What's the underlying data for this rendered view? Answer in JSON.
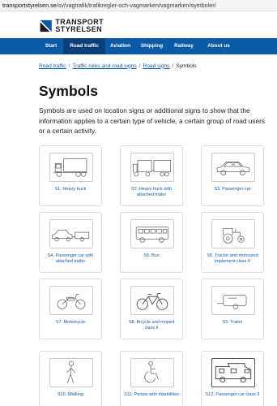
{
  "browser": {
    "url_host": "transportstyrelsen.se",
    "url_path": "/sv/vagtrafik/trafikregler-och-vagmarken/vagmarken/symboler/"
  },
  "brand": {
    "logo_line1": "TRANSPORT",
    "logo_line2": "STYRELSEN",
    "accent_color": "#0a5aa8"
  },
  "nav": {
    "items": [
      {
        "label": "Start"
      },
      {
        "label": "Road traffic",
        "active": true
      },
      {
        "label": "Aviation"
      },
      {
        "label": "Shipping"
      },
      {
        "label": "Railway"
      },
      {
        "label": "About us"
      }
    ]
  },
  "breadcrumb": {
    "items": [
      "Road traffic",
      "Traffic rules and road signs",
      "Road signs"
    ],
    "current": "Symbols"
  },
  "page": {
    "title": "Symbols",
    "intro": "Symbols are used on location signs or additional signs to show that the information applies to a certain type of vehicle, a certain group of road users or a certain activity."
  },
  "symbols": [
    {
      "caption": "S1. Heavy truck",
      "icon": "heavy-truck-icon"
    },
    {
      "caption": "S2. Heavy truck with attached trailer",
      "icon": "truck-trailer-icon"
    },
    {
      "caption": "S3. Passenger car",
      "icon": "passenger-car-icon"
    },
    {
      "caption": "S4. Passenger car with attached trailer",
      "icon": "car-trailer-icon"
    },
    {
      "caption": "S5. Bus",
      "icon": "bus-icon"
    },
    {
      "caption": "S6. Tractor and motorized implement class II",
      "icon": "tractor-icon"
    },
    {
      "caption": "S7. Motorcycle",
      "icon": "motorcycle-icon"
    },
    {
      "caption": "S8. Bicycle and moped class II",
      "icon": "bicycle-icon"
    },
    {
      "caption": "S9. Trailer",
      "icon": "trailer-icon"
    },
    {
      "caption": "S10. Walking",
      "icon": "pedestrian-icon"
    },
    {
      "caption": "S11. People with disabilities",
      "icon": "wheelchair-icon"
    },
    {
      "caption": "S12. Passenger car class II",
      "icon": "camper-icon"
    }
  ]
}
